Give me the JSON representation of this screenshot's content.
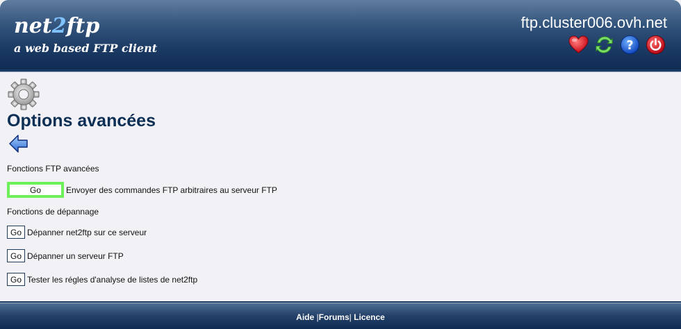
{
  "header": {
    "logo_prefix": "net",
    "logo_two": "2",
    "logo_suffix": "ftp",
    "logo_subtitle": "a web based FTP client",
    "server": "ftp.cluster006.ovh.net",
    "icons": [
      "bookmark-heart-icon",
      "refresh-icon",
      "help-icon",
      "logout-power-icon"
    ]
  },
  "main": {
    "title": "Options avancées",
    "sections": [
      {
        "label": "Fonctions FTP avancées",
        "items": [
          {
            "button": "Go",
            "description": "Envoyer des commandes FTP arbitraires au serveur FTP"
          }
        ]
      },
      {
        "label": "Fonctions de dépannage",
        "items": [
          {
            "button": "Go",
            "description": "Dépanner net2ftp sur ce serveur"
          },
          {
            "button": "Go",
            "description": "Dépanner un serveur FTP"
          },
          {
            "button": "Go",
            "description": "Tester les régles d'analyse de listes de net2ftp"
          }
        ]
      }
    ]
  },
  "footer": {
    "links": [
      "Aide",
      "Forums",
      "Licence"
    ],
    "separator": "|"
  },
  "colors": {
    "header_dark": "#0f2c55",
    "title": "#0c2f55",
    "highlight": "#6ef05a"
  }
}
